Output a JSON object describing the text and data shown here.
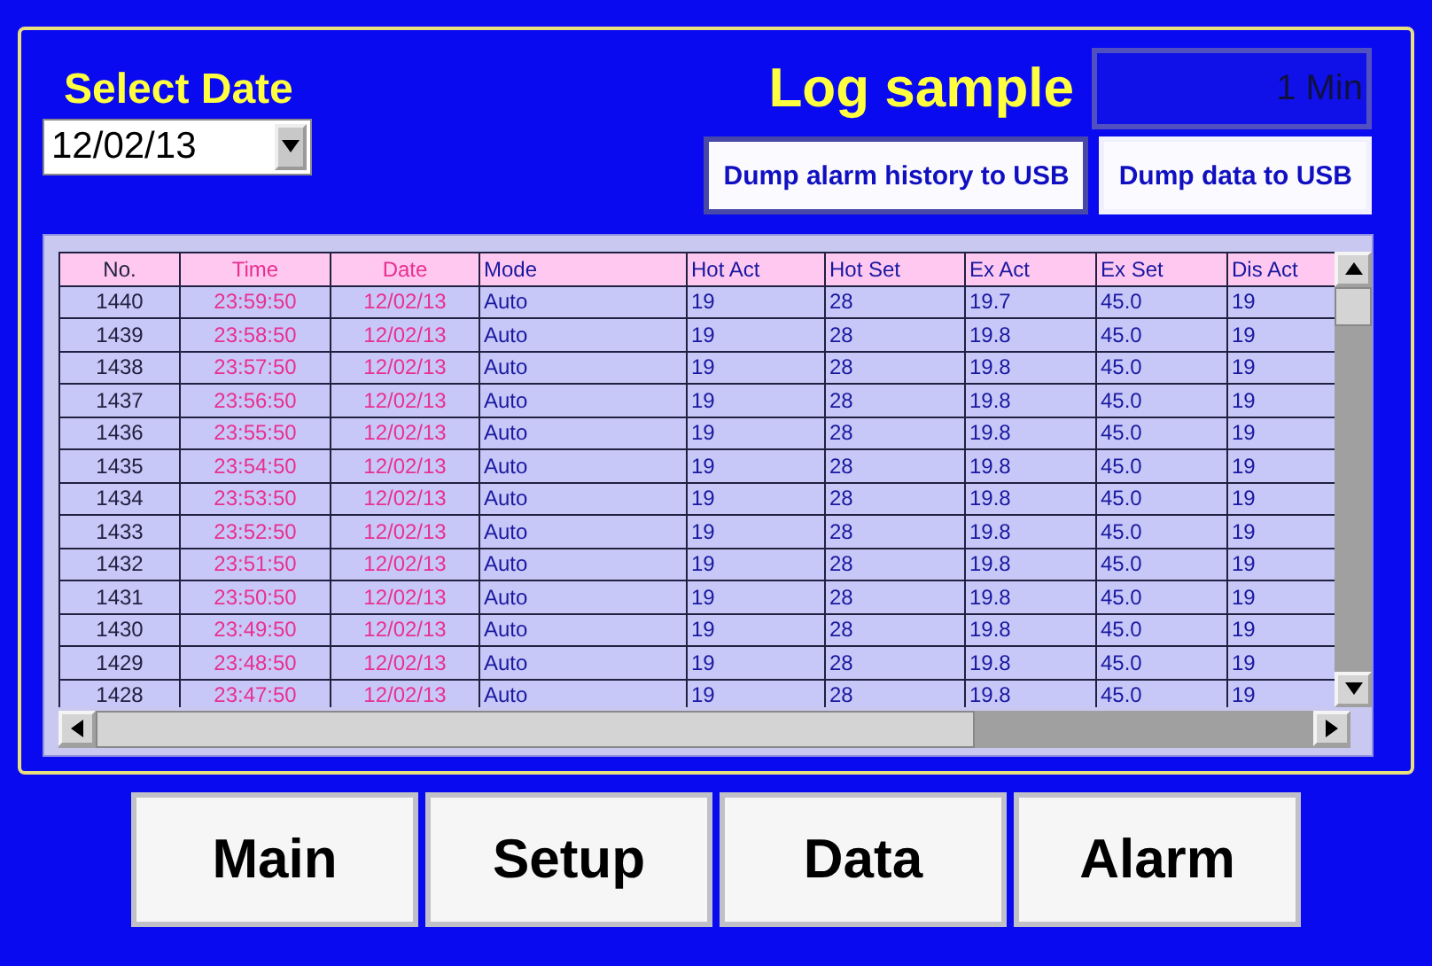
{
  "select_date": {
    "label": "Select Date",
    "value": "12/02/13"
  },
  "log_sample": {
    "label": "Log sample",
    "value": "1 Min"
  },
  "actions": [
    "Dump alarm history to USB",
    "Dump data to USB"
  ],
  "table": {
    "columns": [
      {
        "label": "No.",
        "kind": "index"
      },
      {
        "label": "Time",
        "kind": "timestamp"
      },
      {
        "label": "Date",
        "kind": "timestamp"
      },
      {
        "label": "Mode",
        "kind": "value"
      },
      {
        "label": "Hot Act",
        "kind": "value"
      },
      {
        "label": "Hot Set",
        "kind": "value"
      },
      {
        "label": "Ex Act",
        "kind": "value"
      },
      {
        "label": "Ex Set",
        "kind": "value"
      },
      {
        "label": "Dis Act",
        "kind": "value"
      }
    ],
    "rows": [
      [
        "1440",
        "23:59:50",
        "12/02/13",
        "Auto",
        "19",
        "28",
        "19.7",
        "45.0",
        "19"
      ],
      [
        "1439",
        "23:58:50",
        "12/02/13",
        "Auto",
        "19",
        "28",
        "19.8",
        "45.0",
        "19"
      ],
      [
        "1438",
        "23:57:50",
        "12/02/13",
        "Auto",
        "19",
        "28",
        "19.8",
        "45.0",
        "19"
      ],
      [
        "1437",
        "23:56:50",
        "12/02/13",
        "Auto",
        "19",
        "28",
        "19.8",
        "45.0",
        "19"
      ],
      [
        "1436",
        "23:55:50",
        "12/02/13",
        "Auto",
        "19",
        "28",
        "19.8",
        "45.0",
        "19"
      ],
      [
        "1435",
        "23:54:50",
        "12/02/13",
        "Auto",
        "19",
        "28",
        "19.8",
        "45.0",
        "19"
      ],
      [
        "1434",
        "23:53:50",
        "12/02/13",
        "Auto",
        "19",
        "28",
        "19.8",
        "45.0",
        "19"
      ],
      [
        "1433",
        "23:52:50",
        "12/02/13",
        "Auto",
        "19",
        "28",
        "19.8",
        "45.0",
        "19"
      ],
      [
        "1432",
        "23:51:50",
        "12/02/13",
        "Auto",
        "19",
        "28",
        "19.8",
        "45.0",
        "19"
      ],
      [
        "1431",
        "23:50:50",
        "12/02/13",
        "Auto",
        "19",
        "28",
        "19.8",
        "45.0",
        "19"
      ],
      [
        "1430",
        "23:49:50",
        "12/02/13",
        "Auto",
        "19",
        "28",
        "19.8",
        "45.0",
        "19"
      ],
      [
        "1429",
        "23:48:50",
        "12/02/13",
        "Auto",
        "19",
        "28",
        "19.8",
        "45.0",
        "19"
      ],
      [
        "1428",
        "23:47:50",
        "12/02/13",
        "Auto",
        "19",
        "28",
        "19.8",
        "45.0",
        "19"
      ]
    ]
  },
  "nav_buttons": [
    "Main",
    "Setup",
    "Data",
    "Alarm"
  ]
}
